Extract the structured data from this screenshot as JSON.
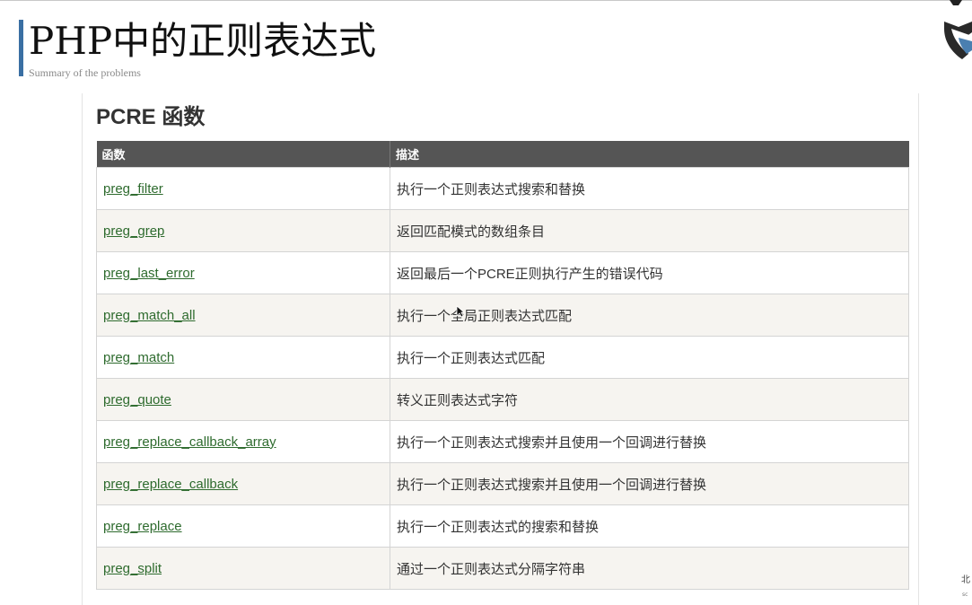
{
  "slide": {
    "title": "PHP中的正则表达式",
    "subtitle": "Summary of the problems",
    "accent_color": "#3a6fa3",
    "logo_icon": "shield-logo-icon",
    "side_text": "北",
    "side_text_small": "sc"
  },
  "doc": {
    "heading": "PCRE 函数",
    "table": {
      "headers": [
        "函数",
        "描述"
      ],
      "rows": [
        {
          "name": "preg_filter",
          "desc": "执行一个正则表达式搜索和替换"
        },
        {
          "name": "preg_grep",
          "desc": "返回匹配模式的数组条目"
        },
        {
          "name": "preg_last_error",
          "desc": "返回最后一个PCRE正则执行产生的错误代码"
        },
        {
          "name": "preg_match_all",
          "desc": "执行一个全局正则表达式匹配"
        },
        {
          "name": "preg_match",
          "desc": "执行一个正则表达式匹配"
        },
        {
          "name": "preg_quote",
          "desc": "转义正则表达式字符"
        },
        {
          "name": "preg_replace_callback_array",
          "desc": "执行一个正则表达式搜索并且使用一个回调进行替换"
        },
        {
          "name": "preg_replace_callback",
          "desc": "执行一个正则表达式搜索并且使用一个回调进行替换"
        },
        {
          "name": "preg_replace",
          "desc": "执行一个正则表达式的搜索和替换"
        },
        {
          "name": "preg_split",
          "desc": "通过一个正则表达式分隔字符串"
        }
      ]
    },
    "link_color": "#2e6b2e",
    "header_color": "#555555"
  },
  "cursor_icon": "mouse-pointer-icon"
}
